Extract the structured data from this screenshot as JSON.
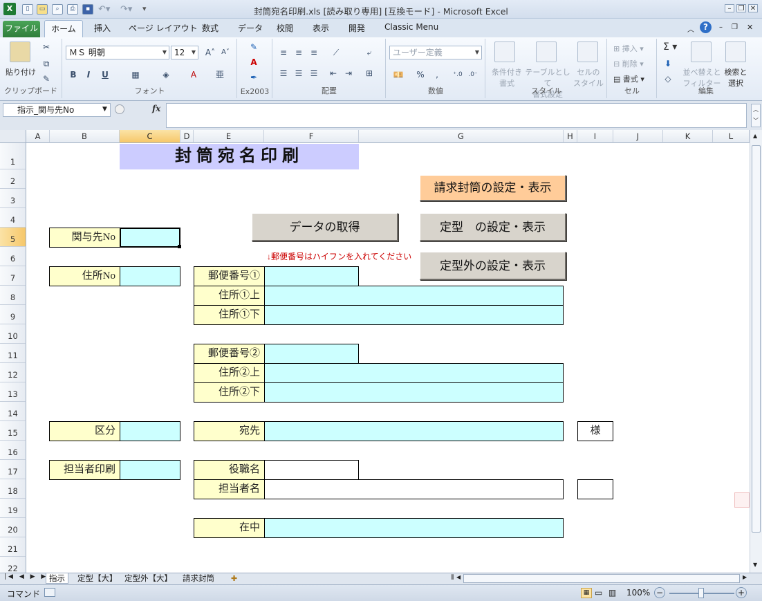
{
  "window": {
    "title": "封筒宛名印刷.xls  [読み取り専用]  [互換モード]  -  Microsoft Excel",
    "app_icon": "excel-logo-icon"
  },
  "ribbon_tabs": [
    "ファイル",
    "ホーム",
    "挿入",
    "ページ レイアウト",
    "数式",
    "データ",
    "校閲",
    "表示",
    "開発",
    "Classic Menu"
  ],
  "ribbon": {
    "clipboard": {
      "paste": "貼り付け",
      "label": "クリップボード"
    },
    "font": {
      "name": "ＭＳ 明朝",
      "size": "12",
      "label": "フォント",
      "bold": "B",
      "italic": "I",
      "underline": "U"
    },
    "ex2003": {
      "label": "Ex2003"
    },
    "alignment": {
      "label": "配置"
    },
    "number": {
      "format": "ユーザー定義",
      "label": "数値",
      "percent": "%",
      "comma": ","
    },
    "styles": {
      "label": "スタイル",
      "cond_line1": "条件付き",
      "cond_line2": "書式",
      "table_line1": "テーブルとして",
      "table_line2": "書式設定",
      "cell_line1": "セルの",
      "cell_line2": "スタイル"
    },
    "cells": {
      "label": "セル",
      "insert": "挿入",
      "delete": "削除",
      "format": "書式"
    },
    "editing": {
      "label": "編集",
      "sort_line1": "並べ替えと",
      "sort_line2": "フィルター",
      "find_line1": "検索と",
      "find_line2": "選択",
      "sum": "Σ"
    }
  },
  "formula_bar": {
    "name_box": "指示_関与先No",
    "fx": "fx",
    "content": ""
  },
  "columns": [
    "A",
    "B",
    "C",
    "D",
    "E",
    "F",
    "G",
    "H",
    "I",
    "J",
    "K",
    "L"
  ],
  "selected_column": "C",
  "rows": [
    "1",
    "2",
    "3",
    "4",
    "5",
    "6",
    "7",
    "8",
    "9",
    "10",
    "11",
    "12",
    "13",
    "14",
    "15",
    "16",
    "17",
    "18",
    "19",
    "20",
    "21",
    "22"
  ],
  "selected_row": "5",
  "sheet": {
    "title": "封筒宛名印刷",
    "buttons": {
      "get_data": "データの取得",
      "seikyu": "請求封筒の設定・表示",
      "teikei": "定型　の設定・表示",
      "teikeigai": "定型外の設定・表示"
    },
    "note": "↓郵便番号はハイフンを入れてください",
    "labels": {
      "kanyo": "関与先No",
      "jusho_no": "住所No",
      "kubun": "区分",
      "tanto_in": "担当者印刷",
      "zip1": "郵便番号①",
      "addr1_top": "住所①上",
      "addr1_bottom": "住所①下",
      "zip2": "郵便番号②",
      "addr2_top": "住所②上",
      "addr2_bottom": "住所②下",
      "atesaki": "宛先",
      "yakushoku": "役職名",
      "tantosha": "担当者名",
      "zaichu": "在中",
      "sama": "様"
    }
  },
  "sheet_tabs": [
    "指示",
    "定型【大】",
    "定型外【大】",
    "請求封筒"
  ],
  "status": {
    "mode": "コマンド",
    "zoom": "100%"
  }
}
